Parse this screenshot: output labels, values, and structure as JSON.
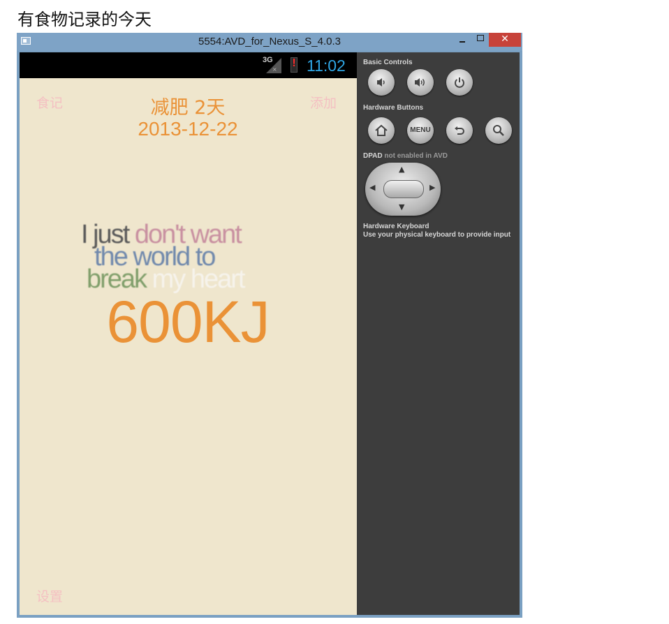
{
  "caption": "有食物记录的今天",
  "window": {
    "title": "5554:AVD_for_Nexus_S_4.0.3",
    "close_glyph": "✕"
  },
  "status_bar": {
    "network": "3G",
    "network_no_data": "×",
    "time": "11:02"
  },
  "app": {
    "nav_left": "食记",
    "nav_right": "添加",
    "nav_bottom": "设置",
    "title": "减肥 2天",
    "date": "2013-12-22",
    "energy_value": "600KJ",
    "quote_image_text": {
      "line1_a": "I just ",
      "line1_b": "don't want",
      "line2": "the world to",
      "line3_a": "break ",
      "line3_b": "my heart"
    }
  },
  "control_panel": {
    "basic_controls_label": "Basic Controls",
    "hardware_buttons_label": "Hardware Buttons",
    "dpad_label": "DPAD",
    "dpad_sub_label": "not enabled in AVD",
    "keyboard_label": "Hardware Keyboard",
    "keyboard_hint": "Use your physical keyboard to provide input",
    "menu_button_label": "MENU",
    "icons": [
      "volume-down-icon",
      "volume-up-icon",
      "power-icon",
      "home-icon",
      "menu-icon",
      "back-icon",
      "search-icon"
    ]
  }
}
